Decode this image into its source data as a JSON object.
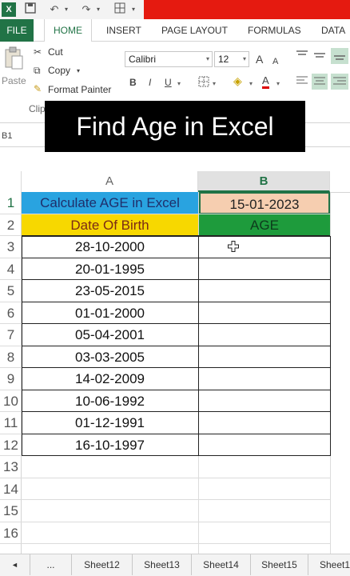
{
  "qat": {
    "icons": [
      "excel-logo-icon",
      "save-icon",
      "undo-icon",
      "redo-icon",
      "border-icon"
    ]
  },
  "ribbon_tabs": [
    "FILE",
    "HOME",
    "INSERT",
    "PAGE LAYOUT",
    "FORMULAS",
    "DATA"
  ],
  "ribbon": {
    "paste_label": "Paste",
    "cut_label": "Cut",
    "copy_label": "Copy",
    "format_painter_label": "Format Painter",
    "clipboard_group_label": "Clip",
    "font_name": "Calibri",
    "font_size": "12",
    "bold": "B",
    "italic": "I",
    "underline": "U",
    "grow_font": "A",
    "shrink_font": "A",
    "font_color": "A"
  },
  "banner": {
    "title": "Find Age in Excel"
  },
  "name_box": "B1",
  "columns": [
    "A",
    "B"
  ],
  "rows": [
    {
      "num": "1",
      "a": "Calculate AGE in Excel",
      "b": "15-01-2023"
    },
    {
      "num": "2",
      "a": "Date Of Birth",
      "b": "AGE"
    },
    {
      "num": "3",
      "a": "28-10-2000",
      "b": ""
    },
    {
      "num": "4",
      "a": "20-01-1995",
      "b": ""
    },
    {
      "num": "5",
      "a": "23-05-2015",
      "b": ""
    },
    {
      "num": "6",
      "a": "01-01-2000",
      "b": ""
    },
    {
      "num": "7",
      "a": "05-04-2001",
      "b": ""
    },
    {
      "num": "8",
      "a": "03-03-2005",
      "b": ""
    },
    {
      "num": "9",
      "a": "14-02-2009",
      "b": ""
    },
    {
      "num": "10",
      "a": "10-06-1992",
      "b": ""
    },
    {
      "num": "11",
      "a": "01-12-1991",
      "b": ""
    },
    {
      "num": "12",
      "a": "16-10-1997",
      "b": ""
    },
    {
      "num": "13",
      "a": "",
      "b": ""
    },
    {
      "num": "14",
      "a": "",
      "b": ""
    },
    {
      "num": "15",
      "a": "",
      "b": ""
    },
    {
      "num": "16",
      "a": "",
      "b": ""
    }
  ],
  "sheet_nav": {
    "prev": "◄",
    "more": "..."
  },
  "sheets": [
    "Sheet12",
    "Sheet13",
    "Sheet14",
    "Sheet15",
    "Sheet1"
  ],
  "colors": {
    "excel_green": "#217346",
    "title_cell_bg": "#29a3e0",
    "title_cell_text": "#1f2f6b",
    "date_header_bg": "#f7d800",
    "date_header_text": "#7a2a16",
    "age_header_bg": "#1e9b3c",
    "reference_date_bg": "#f6ceb0"
  }
}
